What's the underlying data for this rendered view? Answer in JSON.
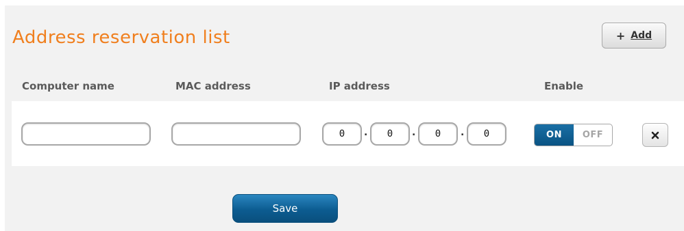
{
  "section": {
    "title": "Address reservation list",
    "add_button": {
      "icon": "plus-icon",
      "plus_symbol": "+",
      "label": "Add"
    }
  },
  "table": {
    "headers": {
      "computer_name": "Computer name",
      "mac_address": "MAC address",
      "ip_address": "IP address",
      "enable": "Enable"
    },
    "row": {
      "computer_name": "",
      "mac_address": "",
      "ip_octets": [
        "0",
        "0",
        "0",
        "0"
      ],
      "ip_separator": ".",
      "enable": {
        "on_label": "ON",
        "off_label": "OFF",
        "state": "on"
      },
      "delete_icon": "close-icon"
    }
  },
  "actions": {
    "save_label": "Save"
  },
  "colors": {
    "title": "#f07f1e",
    "primary_blue": "#0c5c91",
    "panel_background": "#f2f2f2"
  }
}
